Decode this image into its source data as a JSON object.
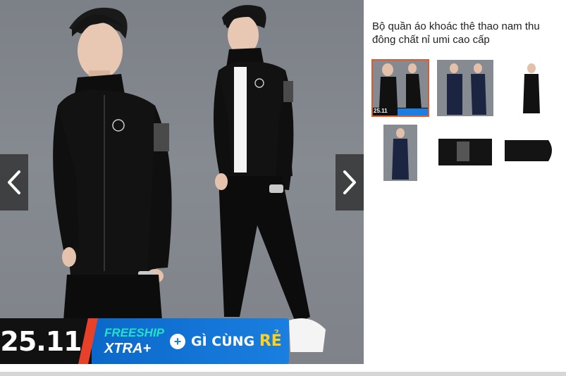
{
  "product": {
    "title": "Bộ quần áo khoác thê thao nam thu đông chất nỉ umi cao cấp"
  },
  "gallery": {
    "prev_icon": "chevron-left-icon",
    "next_icon": "chevron-right-icon",
    "selected_index": 0,
    "thumbnail_count": 6
  },
  "promo": {
    "date": "25.11",
    "freeship_line1": "FREESHIP",
    "freeship_line2": "XTRA+",
    "plus_icon": "plus-icon",
    "cheap_text": "GÌ CÙNG",
    "cheap_accent": "RẺ"
  },
  "thumb_promo": {
    "date": "25.11"
  },
  "colors": {
    "accent": "#e05a2b",
    "promo_blue": "#1a7fe0",
    "freeship_teal": "#21e3c4",
    "cheap_yellow": "#ffd21f"
  }
}
